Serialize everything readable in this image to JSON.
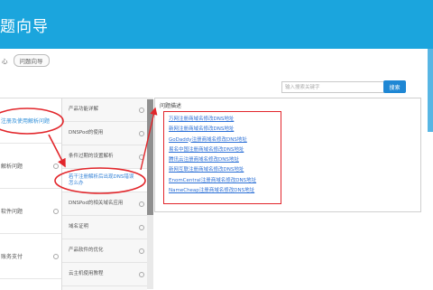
{
  "header": {
    "title": "题向导"
  },
  "breadcrumb": {
    "parent": "心",
    "current": "问题向导"
  },
  "search": {
    "placeholder": "输入搜索关键字",
    "button_label": "搜索"
  },
  "categories": [
    {
      "label": "注册及使用解析问题",
      "active": true
    },
    {
      "label": "解析问题",
      "active": false
    },
    {
      "label": "软件问题",
      "active": false
    },
    {
      "label": "账务支付",
      "active": false
    }
  ],
  "subcategories": [
    {
      "label": "产品功能详解",
      "active": false
    },
    {
      "label": "DNSPod的使用",
      "active": false
    },
    {
      "label": "条件过期的设置解析",
      "active": false
    },
    {
      "label": "若干注册解析后出现DNS错误怎么办",
      "active": true
    },
    {
      "label": "DNSPod的相关域名应用",
      "active": false
    },
    {
      "label": "域名证明",
      "active": false
    },
    {
      "label": "产品软件的优化",
      "active": false
    },
    {
      "label": "云主机使用教程",
      "active": false
    }
  ],
  "panel": {
    "heading": "问题描述",
    "links": [
      "万网注册商域名修改DNS地址",
      "新网注册商域名修改DNS地址",
      "GoDaddy注册商域名修改DNS地址",
      "易名中国注册商域名修改DNS地址",
      "腾讯云注册商域名修改DNS地址",
      "新网互联注册商域名修改DNS地址",
      "EnomCentral注册商域名修改DNS地址",
      "NameCheap注册商域名修改DNS地址"
    ]
  },
  "colors": {
    "header": "#1ba5dd",
    "button": "#1f87d4",
    "link": "#2b6fd6",
    "annotation": "#e2262b"
  }
}
